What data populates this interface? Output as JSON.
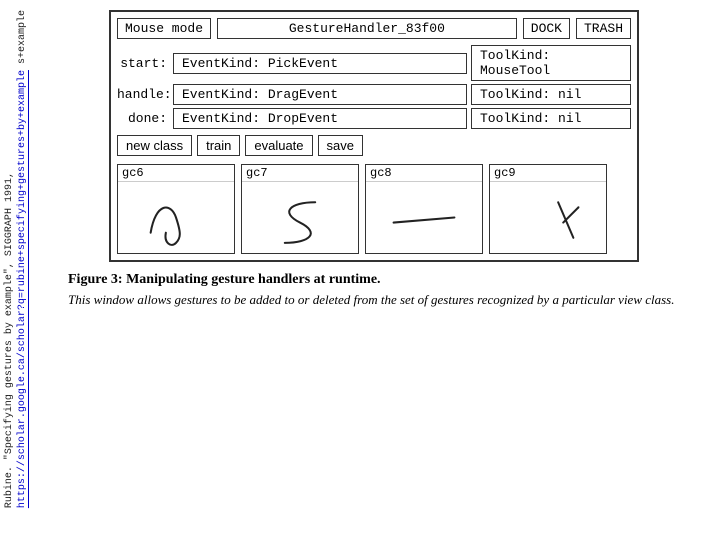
{
  "sidebar": {
    "line1": "Rubine. \"Specifying gestures by example\", SIGGRAPH 1991,",
    "link_text": "https://scholar.google.ca/scholar?q=rubine+specifying+gestures+by+example",
    "link_suffix": "s+example"
  },
  "window": {
    "mouse_mode_label": "Mouse mode",
    "gesture_name": "GestureHandler_83f00",
    "dock_label": "DOCK",
    "trash_label": "TRASH",
    "rows": [
      {
        "label": "start:",
        "event": "EventKind: PickEvent",
        "tool": "ToolKind: MouseTool"
      },
      {
        "label": "handle:",
        "event": "EventKind: DragEvent",
        "tool": "ToolKind: nil"
      },
      {
        "label": "done:",
        "event": "EventKind: DropEvent",
        "tool": "ToolKind: nil"
      }
    ],
    "buttons": [
      "new class",
      "train",
      "evaluate",
      "save"
    ],
    "tiles": [
      {
        "label": "gc6",
        "shape": "wave"
      },
      {
        "label": "gc7",
        "shape": "zigzag"
      },
      {
        "label": "gc8",
        "shape": "line"
      },
      {
        "label": "gc9",
        "shape": "cross"
      }
    ]
  },
  "caption": {
    "figure_label": "Figure 3:",
    "figure_title": " Manipulating gesture handlers at runtime.",
    "description": "This window allows gestures to be added to or deleted from the set of gestures recognized by a particular view class."
  }
}
